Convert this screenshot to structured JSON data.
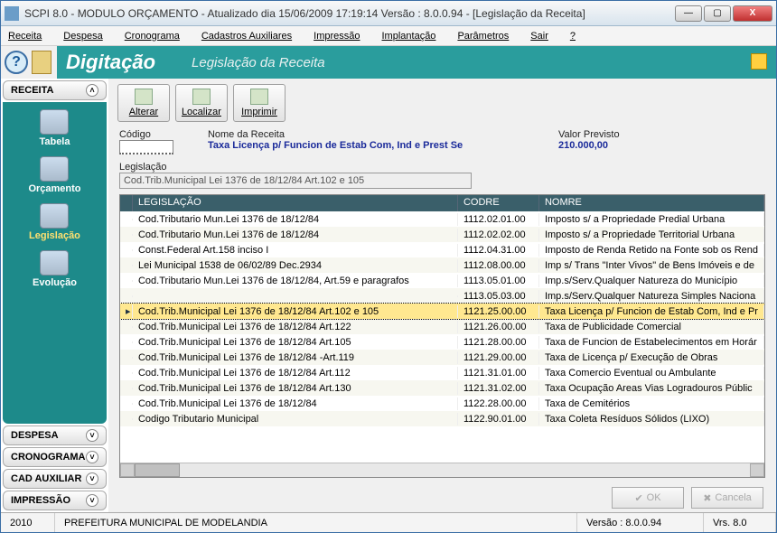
{
  "window": {
    "title": "SCPI 8.0 - MODULO ORÇAMENTO - Atualizado dia 15/06/2009 17:19:14   Versão : 8.0.0.94 - [Legislação da Receita]"
  },
  "menubar": [
    "Receita",
    "Despesa",
    "Cronograma",
    "Cadastros Auxiliares",
    "Impressão",
    "Implantação",
    "Parâmetros",
    "Sair",
    "?"
  ],
  "banner": {
    "title": "Digitação",
    "subtitle": "Legislação da Receita"
  },
  "sidebar": {
    "sections": [
      {
        "label": "RECEITA",
        "expanded": true,
        "items": [
          {
            "label": "Tabela",
            "icon": "tabela-icon"
          },
          {
            "label": "Orçamento",
            "icon": "orcamento-icon"
          },
          {
            "label": "Legislação",
            "icon": "legislacao-icon",
            "active": true
          },
          {
            "label": "Evolução",
            "icon": "evolucao-icon"
          }
        ]
      },
      {
        "label": "DESPESA",
        "expanded": false
      },
      {
        "label": "CRONOGRAMA",
        "expanded": false
      },
      {
        "label": "CAD AUXILIAR",
        "expanded": false
      },
      {
        "label": "IMPRESSÃO",
        "expanded": false
      }
    ]
  },
  "toolbar": {
    "alterar": "Alterar",
    "localizar": "Localizar",
    "imprimir": "Imprimir"
  },
  "form": {
    "codigo_label": "Código",
    "nome_label": "Nome da Receita",
    "valor_label": "Valor Previsto",
    "leg_label": "Legislação",
    "codigo_value": "",
    "nome_value": "Taxa Licença p/ Funcion de Estab Com, Ind e Prest Se",
    "valor_value": "210.000,00",
    "leg_value": "Cod.Trib.Municipal Lei 1376 de 18/12/84 Art.102 e 105"
  },
  "grid": {
    "columns": [
      "LEGISLAÇÃO",
      "CODRE",
      "NOMRE"
    ],
    "rows": [
      {
        "leg": "Cod.Tributario Mun.Lei 1376 de 18/12/84",
        "cod": "1112.02.01.00",
        "nom": "Imposto s/ a Propriedade Predial Urbana"
      },
      {
        "leg": "Cod.Tributario Mun.Lei 1376 de 18/12/84",
        "cod": "1112.02.02.00",
        "nom": "Imposto s/ a Propriedade Territorial Urbana"
      },
      {
        "leg": "Const.Federal Art.158 inciso I",
        "cod": "1112.04.31.00",
        "nom": "Imposto de Renda Retido na Fonte sob os Rend"
      },
      {
        "leg": "Lei Municipal 1538 de 06/02/89 Dec.2934",
        "cod": "1112.08.00.00",
        "nom": "Imp s/ Trans \"Inter Vivos\" de Bens Imóveis e de"
      },
      {
        "leg": "Cod.Tributario Mun.Lei 1376 de 18/12/84, Art.59 e paragrafos",
        "cod": "1113.05.01.00",
        "nom": "Imp.s/Serv.Qualquer Natureza do Município"
      },
      {
        "leg": "",
        "cod": "1113.05.03.00",
        "nom": "Imp.s/Serv.Qualquer Natureza Simples Naciona"
      },
      {
        "leg": "Cod.Trib.Municipal Lei 1376 de 18/12/84 Art.102 e 105",
        "cod": "1121.25.00.00",
        "nom": "Taxa Licença p/ Funcion de Estab Com, Ind e Pr",
        "selected": true
      },
      {
        "leg": "Cod.Trib.Municipal Lei 1376 de 18/12/84  Art.122",
        "cod": "1121.26.00.00",
        "nom": "Taxa de Publicidade Comercial"
      },
      {
        "leg": "Cod.Trib.Municipal Lei 1376 de 18/12/84 Art.105",
        "cod": "1121.28.00.00",
        "nom": "Taxa de Funcion de Estabelecimentos em Horár"
      },
      {
        "leg": "Cod.Trib.Municipal Lei 1376 de 18/12/84 -Art.119",
        "cod": "1121.29.00.00",
        "nom": "Taxa de Licença p/ Execução de Obras"
      },
      {
        "leg": "Cod.Trib.Municipal Lei 1376 de 18/12/84 Art.112",
        "cod": "1121.31.01.00",
        "nom": "Taxa Comercio Eventual ou Ambulante"
      },
      {
        "leg": "Cod.Trib.Municipal Lei 1376 de 18/12/84 Art.130",
        "cod": "1121.31.02.00",
        "nom": "Taxa Ocupação Areas Vias Logradouros Públic"
      },
      {
        "leg": "Cod.Trib.Municipal Lei 1376 de 18/12/84",
        "cod": "1122.28.00.00",
        "nom": "Taxa de Cemitérios"
      },
      {
        "leg": "Codigo Tributario Municipal",
        "cod": "1122.90.01.00",
        "nom": "Taxa Coleta Resíduos Sólidos (LIXO)"
      }
    ]
  },
  "buttons": {
    "ok": "OK",
    "cancel": "Cancela"
  },
  "status": {
    "year": "2010",
    "org": "PREFEITURA MUNICIPAL DE MODELANDIA",
    "ver_long": "Versão : 8.0.0.94",
    "ver_short": "Vrs. 8.0"
  }
}
